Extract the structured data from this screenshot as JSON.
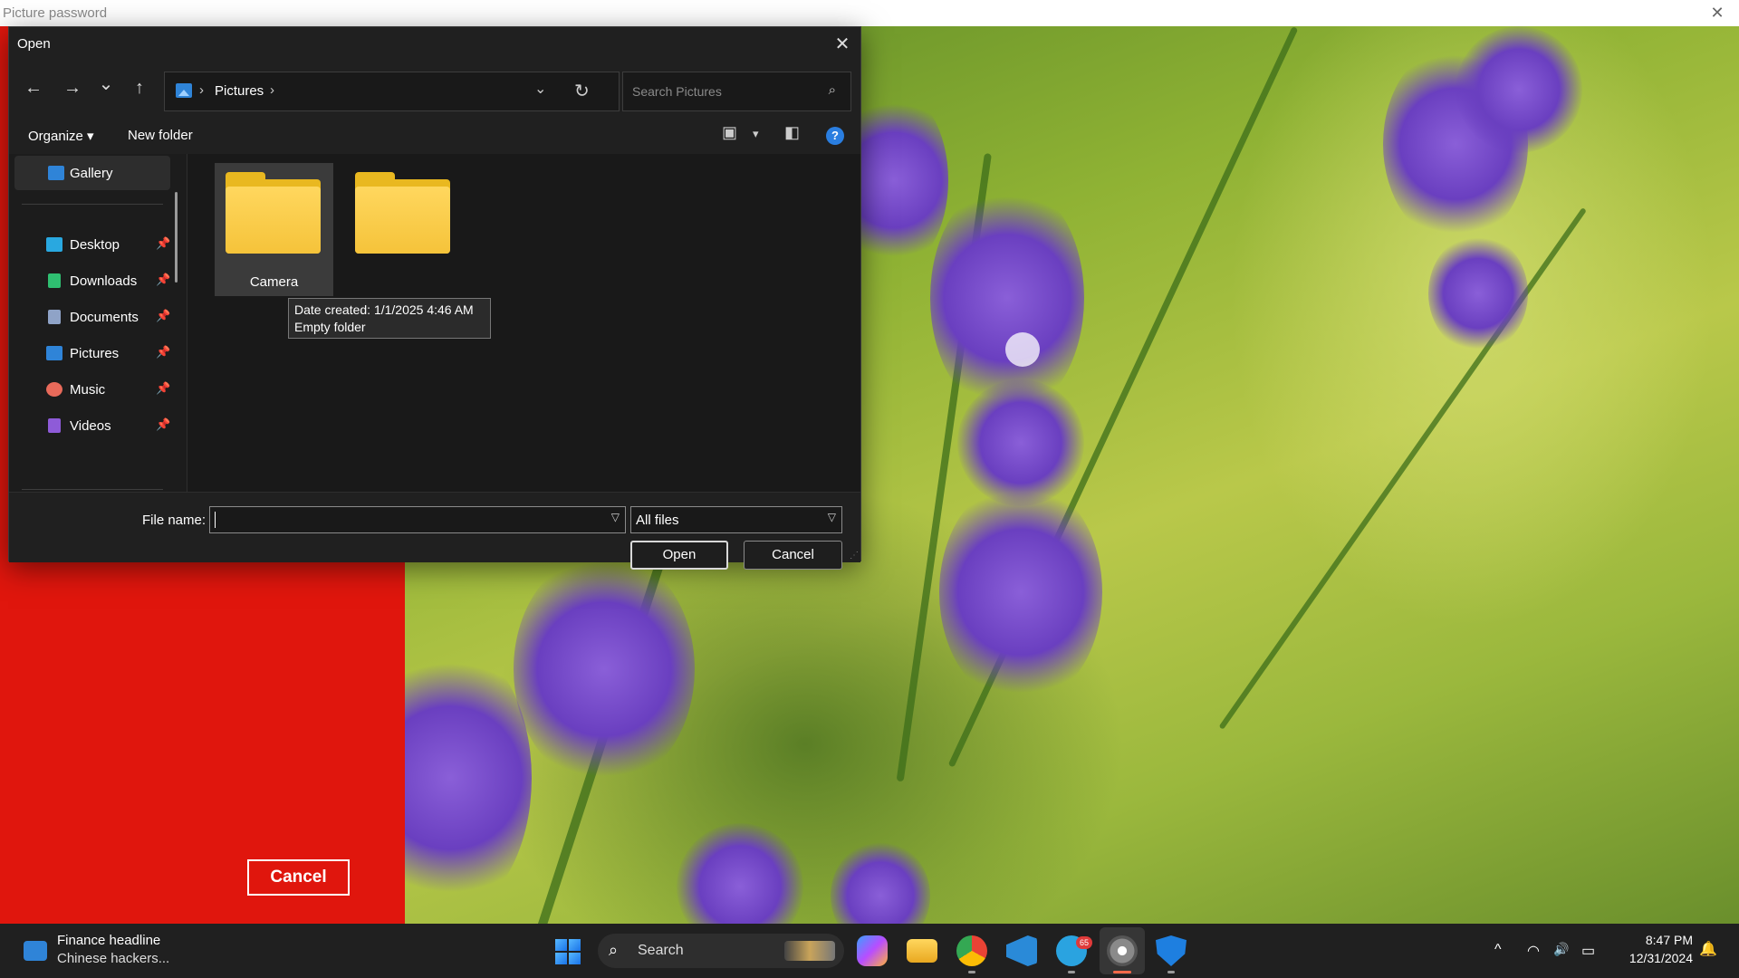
{
  "window": {
    "title": "Picture password",
    "close_glyph": "✕"
  },
  "picture_password": {
    "cancel_label": "Cancel",
    "panel_color": "#e0160d"
  },
  "dialog": {
    "title": "Open",
    "close_glyph": "✕",
    "nav": {
      "back_glyph": "←",
      "forward_glyph": "→",
      "recent_glyph": "⌄",
      "up_glyph": "↑"
    },
    "address": {
      "icon": "pictures-icon",
      "segments": [
        "Pictures"
      ],
      "sep": "›",
      "dropdown_glyph": "⌄",
      "refresh_glyph": "↻"
    },
    "search": {
      "placeholder": "Search Pictures",
      "icon_glyph": "⌕"
    },
    "commands": {
      "organize": "Organize ▾",
      "new_folder": "New folder",
      "view_glyph": "▣",
      "view_dropdown_glyph": "▾",
      "preview_pane_glyph": "◧",
      "help_glyph": "?"
    },
    "nav_pane": {
      "items": [
        {
          "label": "Gallery",
          "icon": "gallery-icon",
          "color": "#2f84d8",
          "pinned": false,
          "selected": true
        },
        {
          "label": "Desktop",
          "icon": "desktop-icon",
          "color": "#29a8e0",
          "pinned": true
        },
        {
          "label": "Downloads",
          "icon": "downloads-icon",
          "color": "#2fbf71",
          "pinned": true
        },
        {
          "label": "Documents",
          "icon": "documents-icon",
          "color": "#8fa3c7",
          "pinned": true
        },
        {
          "label": "Pictures",
          "icon": "pictures-icon",
          "color": "#2f84d8",
          "pinned": true
        },
        {
          "label": "Music",
          "icon": "music-icon",
          "color": "#e86a5a",
          "pinned": true
        },
        {
          "label": "Videos",
          "icon": "videos-icon",
          "color": "#8e5bd8",
          "pinned": true
        }
      ],
      "pin_glyph": "📌"
    },
    "folders": [
      {
        "name": "Camera",
        "selected": true
      },
      {
        "name": "",
        "selected": false
      }
    ],
    "tooltip": {
      "line1": "Date created: 1/1/2025 4:46 AM",
      "line2": "Empty folder"
    },
    "file_name_label": "File name:",
    "file_name_value": "",
    "file_type": "All files",
    "open_label": "Open",
    "cancel_label": "Cancel"
  },
  "taskbar": {
    "news_title": "Finance headline",
    "news_sub": "Chinese hackers...",
    "search_label": "Search",
    "telegram_badge": "65",
    "tray": {
      "chevron_glyph": "^",
      "wifi_glyph": "◠",
      "volume_glyph": "🔊",
      "battery_glyph": "▭"
    },
    "time": "8:47 PM",
    "date": "12/31/2024"
  }
}
